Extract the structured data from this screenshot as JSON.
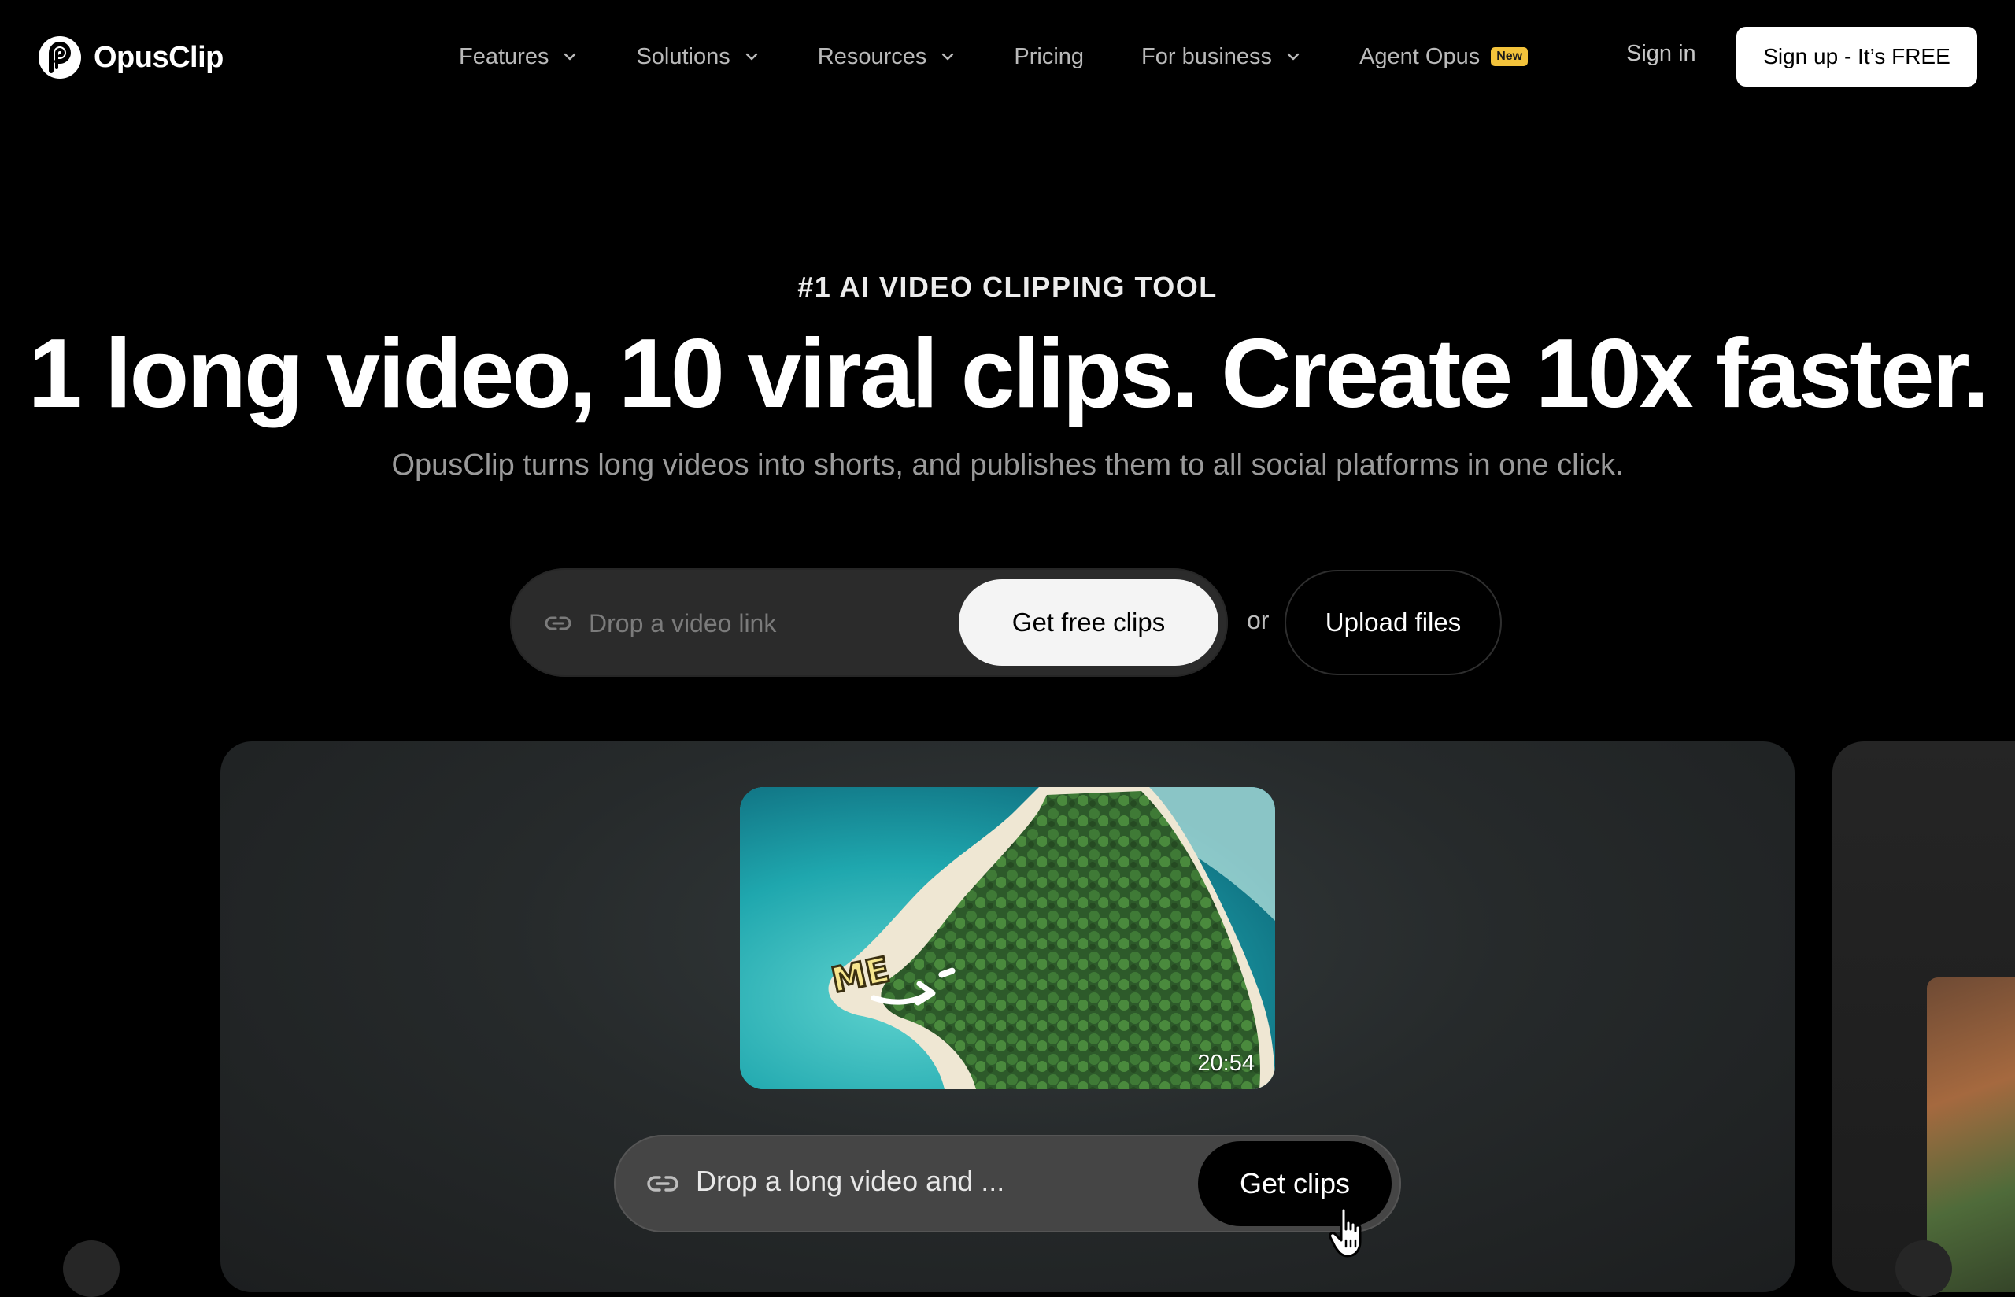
{
  "nav": {
    "logo_text": "OpusClip",
    "menu": [
      {
        "label": "Features",
        "has_dropdown": true
      },
      {
        "label": "Solutions",
        "has_dropdown": true
      },
      {
        "label": "Resources",
        "has_dropdown": true
      },
      {
        "label": "Pricing",
        "has_dropdown": false
      },
      {
        "label": "For business",
        "has_dropdown": true
      },
      {
        "label": "Agent Opus",
        "has_dropdown": false,
        "badge": "New"
      }
    ],
    "signin_label": "Sign in",
    "signup_label": "Sign up - It’s FREE"
  },
  "hero": {
    "eyebrow": "#1 AI VIDEO CLIPPING TOOL",
    "headline": "1 long video, 10 viral clips. Create 10x faster.",
    "subhead": "OpusClip turns long videos into shorts, and publishes them to all social platforms in one click.",
    "link_placeholder": "Drop a video link",
    "get_free_clips_label": "Get free clips",
    "or_label": "or",
    "upload_label": "Upload files"
  },
  "demo": {
    "video_duration": "20:54",
    "input_text": "Drop a long video and ...",
    "get_clips_label": "Get clips"
  },
  "icons": {
    "logo": "opusclip-logo-icon",
    "chevron": "chevron-down-icon",
    "link": "link-icon",
    "cursor": "hand-pointer-icon"
  },
  "colors": {
    "background": "#000000",
    "badge": "#f3c33b",
    "muted_text": "#9a9a9a"
  }
}
